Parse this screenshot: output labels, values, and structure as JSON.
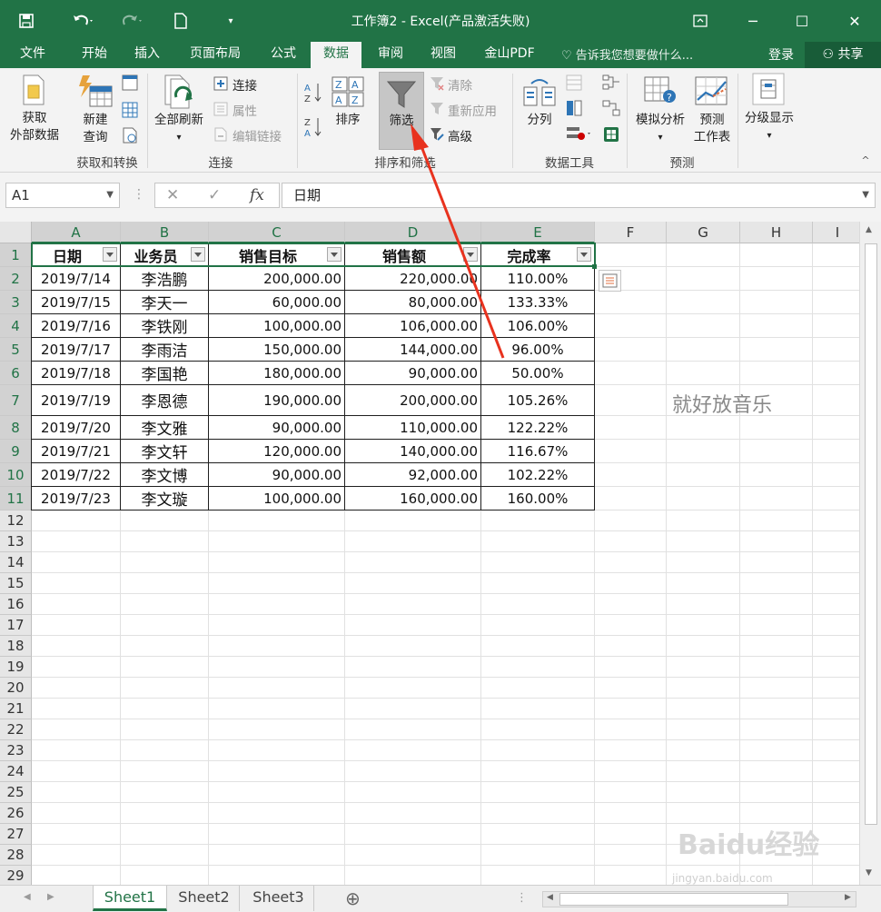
{
  "window": {
    "title": "工作簿2 - Excel(产品激活失败)",
    "restore_icon": "ribbon-display-icon",
    "minimize_label": "─",
    "maximize_label": "☐",
    "close_label": "✕"
  },
  "tabs": [
    {
      "label": "文件"
    },
    {
      "label": "开始"
    },
    {
      "label": "插入"
    },
    {
      "label": "页面布局"
    },
    {
      "label": "公式"
    },
    {
      "label": "数据"
    },
    {
      "label": "审阅"
    },
    {
      "label": "视图"
    },
    {
      "label": "金山PDF"
    }
  ],
  "tell_me": "告诉我您想要做什么...",
  "login": "登录",
  "share": "共享",
  "ribbon": {
    "get_external_1": "获取",
    "get_external_2": "外部数据",
    "new_query_1": "新建",
    "new_query_2": "查询",
    "group_get_transform": "获取和转换",
    "refresh_all": "全部刷新",
    "connections": "连接",
    "properties": "属性",
    "edit_links": "编辑链接",
    "group_connections": "连接",
    "sort": "排序",
    "filter": "筛选",
    "clear": "清除",
    "reapply": "重新应用",
    "advanced": "高级",
    "group_sort_filter": "排序和筛选",
    "text_to_columns": "分列",
    "group_data_tools": "数据工具",
    "what_if_1": "模拟分析",
    "forecast_1": "预测",
    "forecast_2": "工作表",
    "group_forecast": "预测",
    "outline": "分级显示"
  },
  "formula_bar": {
    "name_box": "A1",
    "cancel": "✕",
    "enter": "✓",
    "fx": "fx",
    "value": "日期"
  },
  "columns": [
    "A",
    "B",
    "C",
    "D",
    "E",
    "F",
    "G",
    "H",
    "I"
  ],
  "rows": [
    "1",
    "2",
    "3",
    "4",
    "5",
    "6",
    "7",
    "8",
    "9",
    "10",
    "11",
    "12",
    "13",
    "14",
    "15",
    "16",
    "17",
    "18",
    "19",
    "20",
    "21",
    "22",
    "23",
    "24",
    "25",
    "26",
    "27",
    "28",
    "29"
  ],
  "table": {
    "headers": [
      "日期",
      "业务员",
      "销售目标",
      "销售额",
      "完成率"
    ],
    "data": [
      [
        "2019/7/14",
        "李浩鹏",
        "200,000.00",
        "220,000.00",
        "110.00%"
      ],
      [
        "2019/7/15",
        "李天一",
        "60,000.00",
        "80,000.00",
        "133.33%"
      ],
      [
        "2019/7/16",
        "李铁刚",
        "100,000.00",
        "106,000.00",
        "106.00%"
      ],
      [
        "2019/7/17",
        "李雨洁",
        "150,000.00",
        "144,000.00",
        "96.00%"
      ],
      [
        "2019/7/18",
        "李国艳",
        "180,000.00",
        "90,000.00",
        "50.00%"
      ],
      [
        "2019/7/19",
        "李恩德",
        "190,000.00",
        "200,000.00",
        "105.26%"
      ],
      [
        "2019/7/20",
        "李文雅",
        "90,000.00",
        "110,000.00",
        "122.22%"
      ],
      [
        "2019/7/21",
        "李文轩",
        "120,000.00",
        "140,000.00",
        "116.67%"
      ],
      [
        "2019/7/22",
        "李文博",
        "90,000.00",
        "92,000.00",
        "102.22%"
      ],
      [
        "2019/7/23",
        "李文璇",
        "100,000.00",
        "160,000.00",
        "160.00%"
      ]
    ]
  },
  "floating_text": "就好放音乐",
  "sheets": [
    {
      "label": "Sheet1"
    },
    {
      "label": "Sheet2"
    },
    {
      "label": "Sheet3"
    }
  ],
  "add_sheet": "⊕",
  "watermark": "Baidu经验",
  "watermark_url": "jingyan.baidu.com",
  "colors": {
    "excel_green": "#217346",
    "annotation_arrow": "#e8321e"
  }
}
